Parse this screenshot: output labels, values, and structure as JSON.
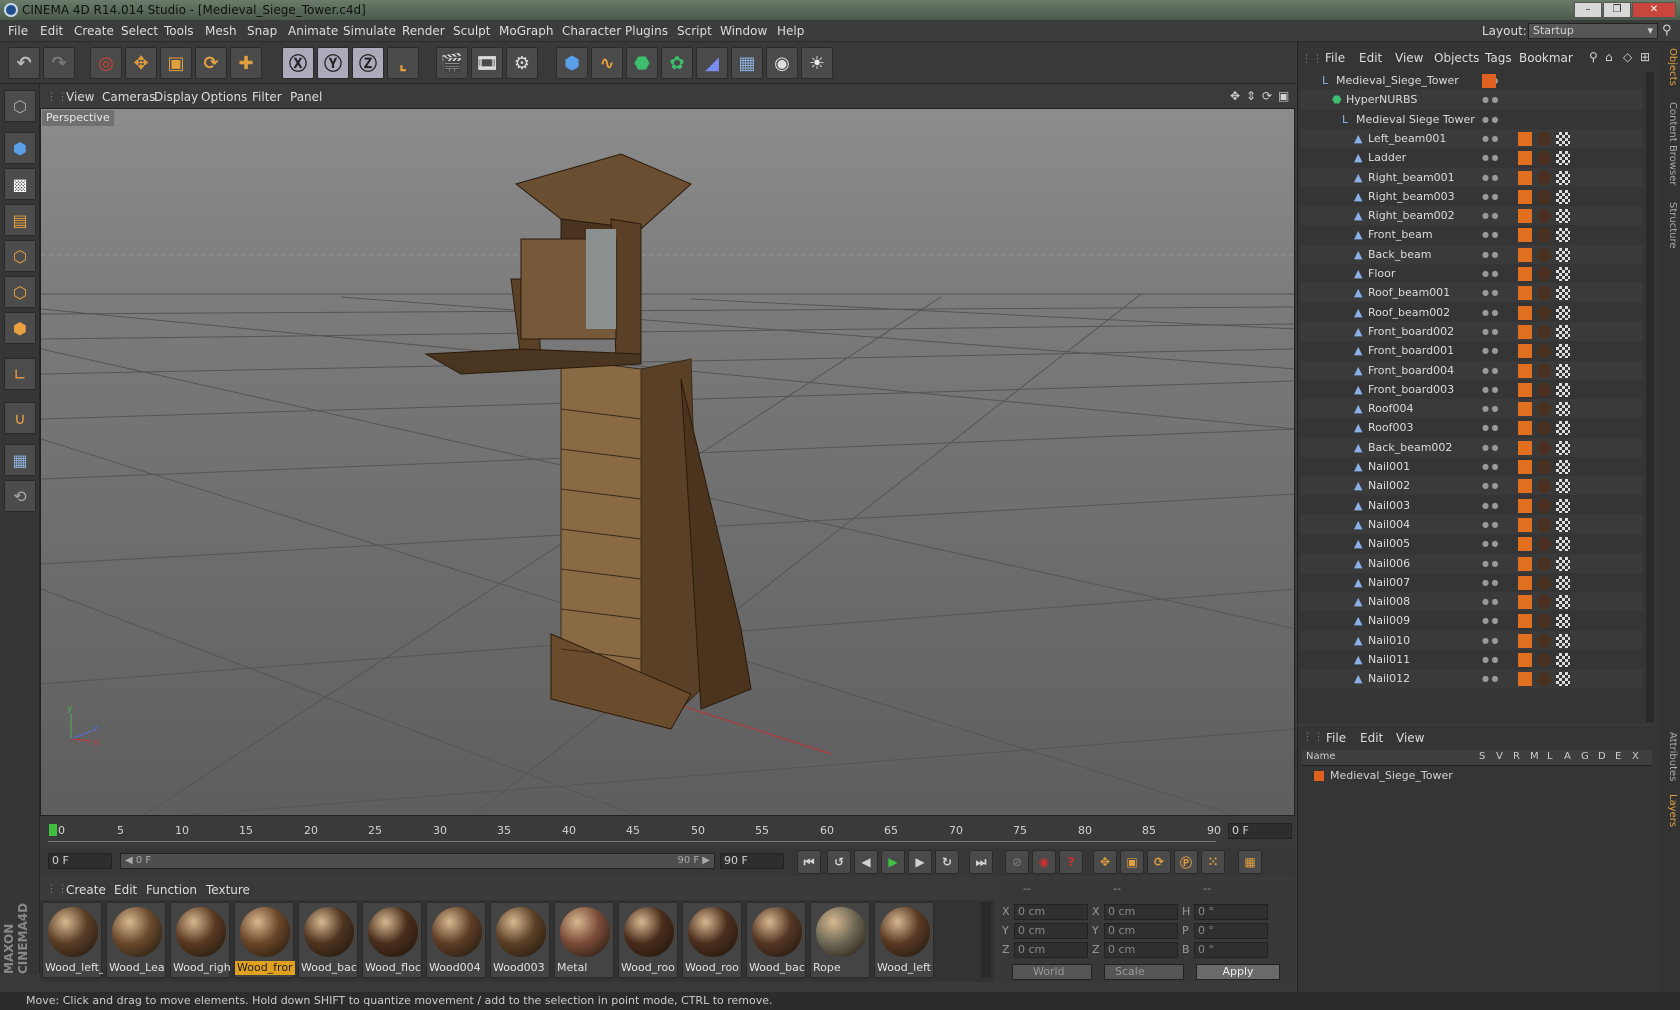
{
  "title_bar": {
    "title": "CINEMA 4D R14.014 Studio - [Medieval_Siege_Tower.c4d]"
  },
  "menubar": {
    "items": [
      "File",
      "Edit",
      "Create",
      "Select",
      "Tools",
      "Mesh",
      "Snap",
      "Animate",
      "Simulate",
      "Render",
      "Sculpt",
      "MoGraph",
      "Character",
      "Plugins",
      "Script",
      "Window",
      "Help"
    ],
    "layout_label": "Layout:",
    "layout_value": "Startup"
  },
  "viewport": {
    "menu": [
      "View",
      "Cameras",
      "Display",
      "Options",
      "Filter",
      "Panel"
    ],
    "label": "Perspective"
  },
  "timeline": {
    "ticks": [
      "0",
      "5",
      "10",
      "15",
      "20",
      "25",
      "30",
      "35",
      "40",
      "45",
      "50",
      "55",
      "60",
      "65",
      "70",
      "75",
      "80",
      "85",
      "90"
    ],
    "current_frame": "0 F",
    "start_field": "0 F",
    "range_start": "◀ 0 F",
    "range_end": "90 F ▶",
    "end_field": "90 F"
  },
  "materials": {
    "menu": [
      "Create",
      "Edit",
      "Function",
      "Texture"
    ],
    "items": [
      {
        "name": "Wood_left_",
        "color": "#5a3e26"
      },
      {
        "name": "Wood_Lea",
        "color": "#6a4a2c"
      },
      {
        "name": "Wood_righ",
        "color": "#5a3a22"
      },
      {
        "name": "Wood_fror",
        "color": "#6b4628",
        "selected": true
      },
      {
        "name": "Wood_bac",
        "color": "#4e3420"
      },
      {
        "name": "Wood_floc",
        "color": "#4a2e1c"
      },
      {
        "name": "Wood004",
        "color": "#5e3e26"
      },
      {
        "name": "Wood003",
        "color": "#5c4026"
      },
      {
        "name": "Metal",
        "color": "#7a4c38"
      },
      {
        "name": "Wood_roo",
        "color": "#4a2c1c"
      },
      {
        "name": "Wood_roo",
        "color": "#4c2e1e"
      },
      {
        "name": "Wood_bac",
        "color": "#553624"
      },
      {
        "name": "Rope",
        "color": "#6e6a56"
      },
      {
        "name": "Wood_left",
        "color": "#5a3a24"
      }
    ]
  },
  "coordinates": {
    "headers": [
      "--",
      "--",
      "--"
    ],
    "rows": [
      {
        "a": "X",
        "av": "0 cm",
        "b": "X",
        "bv": "0 cm",
        "c": "H",
        "cv": "0 °"
      },
      {
        "a": "Y",
        "av": "0 cm",
        "b": "Y",
        "bv": "0 cm",
        "c": "P",
        "cv": "0 °"
      },
      {
        "a": "Z",
        "av": "0 cm",
        "b": "Z",
        "bv": "0 cm",
        "c": "B",
        "cv": "0 °"
      }
    ],
    "mode": "World",
    "size_mode": "Scale",
    "apply": "Apply"
  },
  "object_manager": {
    "menu": [
      "File",
      "Edit",
      "View",
      "Objects",
      "Tags",
      "Bookmar"
    ],
    "objects": [
      {
        "name": "Medieval_Siege_Tower",
        "depth": 0
      },
      {
        "name": "HyperNURBS",
        "depth": 1
      },
      {
        "name": "Medieval Siege Tower",
        "depth": 2
      },
      {
        "name": "Left_beam001",
        "depth": 3
      },
      {
        "name": "Ladder",
        "depth": 3
      },
      {
        "name": "Right_beam001",
        "depth": 3
      },
      {
        "name": "Right_beam003",
        "depth": 3
      },
      {
        "name": "Right_beam002",
        "depth": 3
      },
      {
        "name": "Front_beam",
        "depth": 3
      },
      {
        "name": "Back_beam",
        "depth": 3
      },
      {
        "name": "Floor",
        "depth": 3
      },
      {
        "name": "Roof_beam001",
        "depth": 3
      },
      {
        "name": "Roof_beam002",
        "depth": 3
      },
      {
        "name": "Front_board002",
        "depth": 3
      },
      {
        "name": "Front_board001",
        "depth": 3
      },
      {
        "name": "Front_board004",
        "depth": 3
      },
      {
        "name": "Front_board003",
        "depth": 3
      },
      {
        "name": "Roof004",
        "depth": 3
      },
      {
        "name": "Roof003",
        "depth": 3
      },
      {
        "name": "Back_beam002",
        "depth": 3
      },
      {
        "name": "Nail001",
        "depth": 3
      },
      {
        "name": "Nail002",
        "depth": 3
      },
      {
        "name": "Nail003",
        "depth": 3
      },
      {
        "name": "Nail004",
        "depth": 3
      },
      {
        "name": "Nail005",
        "depth": 3
      },
      {
        "name": "Nail006",
        "depth": 3
      },
      {
        "name": "Nail007",
        "depth": 3
      },
      {
        "name": "Nail008",
        "depth": 3
      },
      {
        "name": "Nail009",
        "depth": 3
      },
      {
        "name": "Nail010",
        "depth": 3
      },
      {
        "name": "Nail011",
        "depth": 3
      },
      {
        "name": "Nail012",
        "depth": 3
      }
    ]
  },
  "layer_manager": {
    "menu": [
      "File",
      "Edit",
      "View"
    ],
    "headers": [
      "Name",
      "S",
      "V",
      "R",
      "M",
      "L",
      "A",
      "G",
      "D",
      "E",
      "X"
    ],
    "layer": "Medieval_Siege_Tower"
  },
  "side_tabs": [
    "Objects",
    "Content Browser",
    "Structure",
    "Attributes",
    "Layers"
  ],
  "status": "Move: Click and drag to move elements. Hold down SHIFT to quantize movement / add to the selection in point mode, CTRL to remove.",
  "brand": "MAXON CINEMA4D"
}
